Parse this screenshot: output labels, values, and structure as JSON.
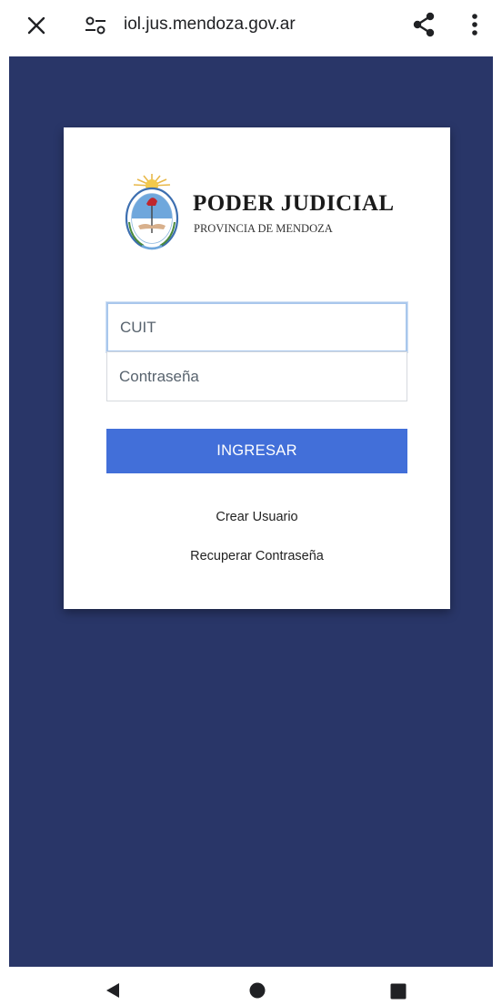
{
  "browser": {
    "url": "iol.jus.mendoza.gov.ar",
    "icons": {
      "close": "close-icon",
      "site_settings": "tune-icon",
      "share": "share-icon",
      "menu": "more-vert-icon"
    }
  },
  "page": {
    "background_color": "#293668",
    "brand": {
      "title": "PODER JUDICIAL",
      "subtitle": "PROVINCIA DE MENDOZA",
      "logo": "coat-of-arms-seal"
    },
    "login": {
      "cuit_placeholder": "CUIT",
      "cuit_value": "",
      "password_placeholder": "Contraseña",
      "password_value": "",
      "submit_label": "INGRESAR",
      "submit_color": "#426fd9",
      "create_user_link": "Crear Usuario",
      "recover_password_link": "Recuperar Contraseña"
    }
  },
  "system_nav": {
    "back": "back-triangle-icon",
    "home": "home-circle-icon",
    "recents": "recents-square-icon"
  }
}
